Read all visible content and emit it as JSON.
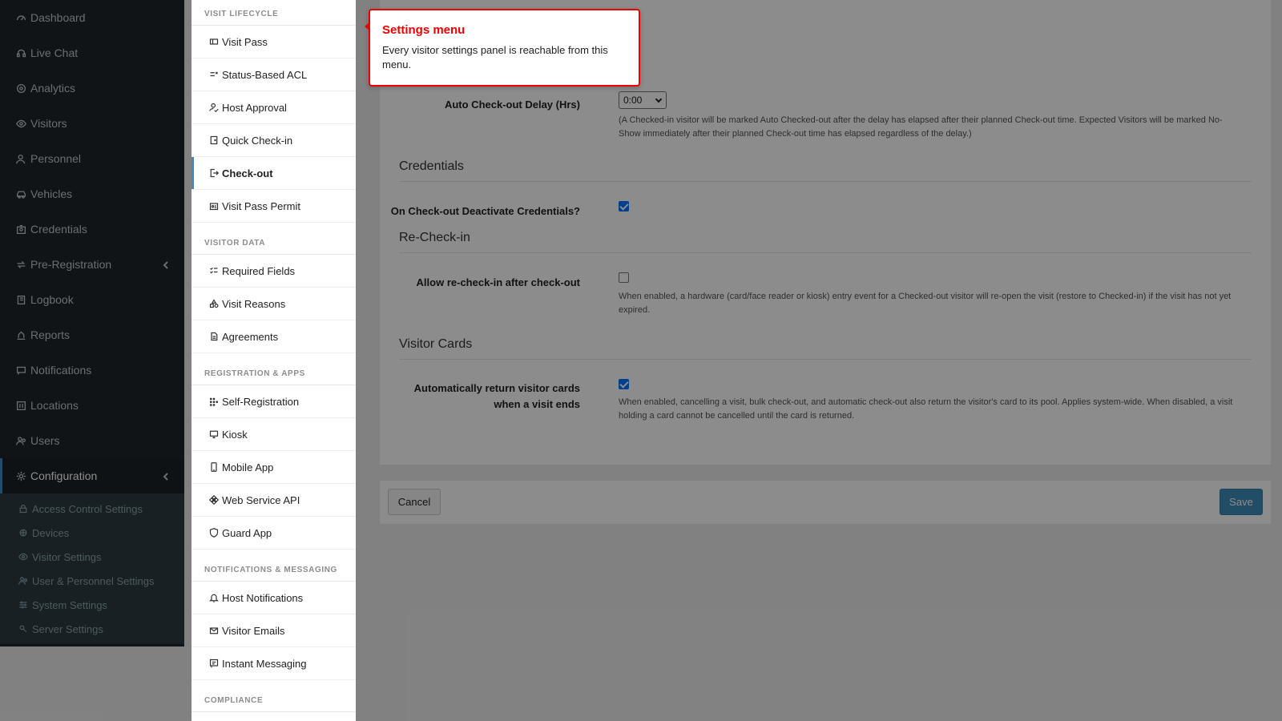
{
  "sidebar": {
    "items": [
      {
        "label": "Dashboard",
        "icon": "gauge-icon"
      },
      {
        "label": "Live Chat",
        "icon": "headset-icon"
      },
      {
        "label": "Analytics",
        "icon": "target-icon"
      },
      {
        "label": "Visitors",
        "icon": "eye-icon"
      },
      {
        "label": "Personnel",
        "icon": "person-icon"
      },
      {
        "label": "Vehicles",
        "icon": "car-icon"
      },
      {
        "label": "Credentials",
        "icon": "badge-icon"
      },
      {
        "label": "Pre-Registration",
        "icon": "arrows-icon"
      },
      {
        "label": "Logbook",
        "icon": "book-icon"
      },
      {
        "label": "Reports",
        "icon": "report-icon"
      },
      {
        "label": "Notifications",
        "icon": "message-icon"
      },
      {
        "label": "Locations",
        "icon": "building-icon"
      },
      {
        "label": "Users",
        "icon": "users-icon"
      },
      {
        "label": "Configuration",
        "icon": "gear-icon"
      }
    ],
    "config_sub": [
      {
        "label": "Access Control Settings",
        "icon": "lock-icon"
      },
      {
        "label": "Devices",
        "icon": "device-icon"
      },
      {
        "label": "Visitor Settings",
        "icon": "eye-icon"
      },
      {
        "label": "User & Personnel Settings",
        "icon": "users-icon"
      },
      {
        "label": "System Settings",
        "icon": "sliders-icon"
      },
      {
        "label": "Server Settings",
        "icon": "server-icon"
      }
    ]
  },
  "settings_menu": {
    "sections": [
      {
        "heading": "VISIT LIFECYCLE",
        "items": [
          {
            "label": "Visit Pass",
            "icon": "ticket-icon"
          },
          {
            "label": "Status-Based ACL",
            "icon": "list-check-icon"
          },
          {
            "label": "Host Approval",
            "icon": "person-check-icon"
          },
          {
            "label": "Quick Check-in",
            "icon": "door-icon"
          },
          {
            "label": "Check-out",
            "icon": "exit-icon"
          },
          {
            "label": "Visit Pass Permit",
            "icon": "id-card-icon"
          }
        ]
      },
      {
        "heading": "VISITOR DATA",
        "items": [
          {
            "label": "Required Fields",
            "icon": "checklist-icon"
          },
          {
            "label": "Visit Reasons",
            "icon": "shapes-icon"
          },
          {
            "label": "Agreements",
            "icon": "document-icon"
          }
        ]
      },
      {
        "heading": "REGISTRATION & APPS",
        "items": [
          {
            "label": "Self-Registration",
            "icon": "grid-dots-icon"
          },
          {
            "label": "Kiosk",
            "icon": "monitor-icon"
          },
          {
            "label": "Mobile App",
            "icon": "phone-icon"
          },
          {
            "label": "Web Service API",
            "icon": "network-icon"
          },
          {
            "label": "Guard App",
            "icon": "shield-icon"
          }
        ]
      },
      {
        "heading": "NOTIFICATIONS & MESSAGING",
        "items": [
          {
            "label": "Host Notifications",
            "icon": "bell-icon"
          },
          {
            "label": "Visitor Emails",
            "icon": "mail-icon"
          },
          {
            "label": "Instant Messaging",
            "icon": "chat-icon"
          }
        ]
      },
      {
        "heading": "COMPLIANCE",
        "items": []
      }
    ],
    "active_item": "Check-out"
  },
  "tooltip": {
    "title": "Settings menu",
    "body": "Every visitor settings panel is reachable from this menu."
  },
  "main": {
    "delay_label": "Auto Check-out Delay (Hrs)",
    "delay_value": "0:00",
    "delay_help": "(A Checked-in visitor will be marked Auto Checked-out after the delay has elapsed after their planned Check-out time. Expected Visitors will be marked No-Show immediately after their planned Check-out time has elapsed regardless of the delay.)",
    "credentials_title": "Credentials",
    "deactivate_label": "On Check-out Deactivate Credentials?",
    "deactivate_checked": true,
    "recheckin_title": "Re-Check-in",
    "recheckin_label": "Allow re-check-in after check-out",
    "recheckin_checked": false,
    "recheckin_help": "When enabled, a hardware (card/face reader or kiosk) entry event for a Checked-out visitor will re-open the visit (restore to Checked-in) if the visit has not yet expired.",
    "cards_title": "Visitor Cards",
    "cards_label_1": "Automatically return visitor cards",
    "cards_label_2": "when a visit ends",
    "cards_checked": true,
    "cards_help": "When enabled, cancelling a visit, bulk check-out, and automatic check-out also return the visitor's card to its pool. Applies system-wide. When disabled, a visit holding a card cannot be cancelled until the card is returned."
  },
  "footer": {
    "cancel_label": "Cancel",
    "save_label": "Save"
  }
}
